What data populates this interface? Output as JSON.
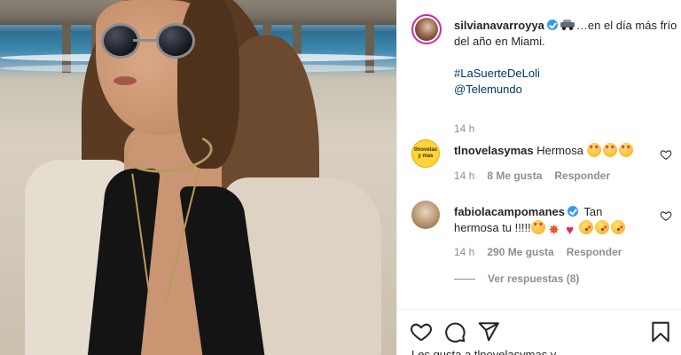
{
  "post": {
    "author": {
      "username": "silvianavarroyya",
      "verified": true,
      "caption_text": "…en el día más frío del año en Miami.",
      "caption_emoji": "car",
      "hashtag": "#LaSuerteDeLoli",
      "mention": "@Telemundo",
      "time": "14 h"
    },
    "comments": [
      {
        "username": "tlnovelasymas",
        "avatar_text": "tlnovelas y mas",
        "text": "Hermosa",
        "emojis": [
          "heart-eyes",
          "heart-eyes",
          "heart-eyes"
        ],
        "time": "14 h",
        "likes": "8 Me gusta",
        "reply": "Responder"
      },
      {
        "username": "fabiolacampomanes",
        "verified": true,
        "text": "Tan hermosa tu !!!!!",
        "emojis": [
          "heart-eyes",
          "collision",
          "red-heart",
          "kiss",
          "kiss",
          "kiss"
        ],
        "time": "14 h",
        "likes": "290 Me gusta",
        "reply": "Responder"
      }
    ],
    "view_replies": "Ver respuestas (8)",
    "likes_line": "Les gusta a tlnovelasymas y ...",
    "icons": {
      "like": "heart-outline-icon",
      "comment": "comment-bubble-icon",
      "share": "paper-plane-icon",
      "save": "bookmark-icon"
    },
    "colors": {
      "link": "#00376b",
      "verified": "#3897f0",
      "muted": "#8e8e8e",
      "text": "#262626"
    }
  }
}
